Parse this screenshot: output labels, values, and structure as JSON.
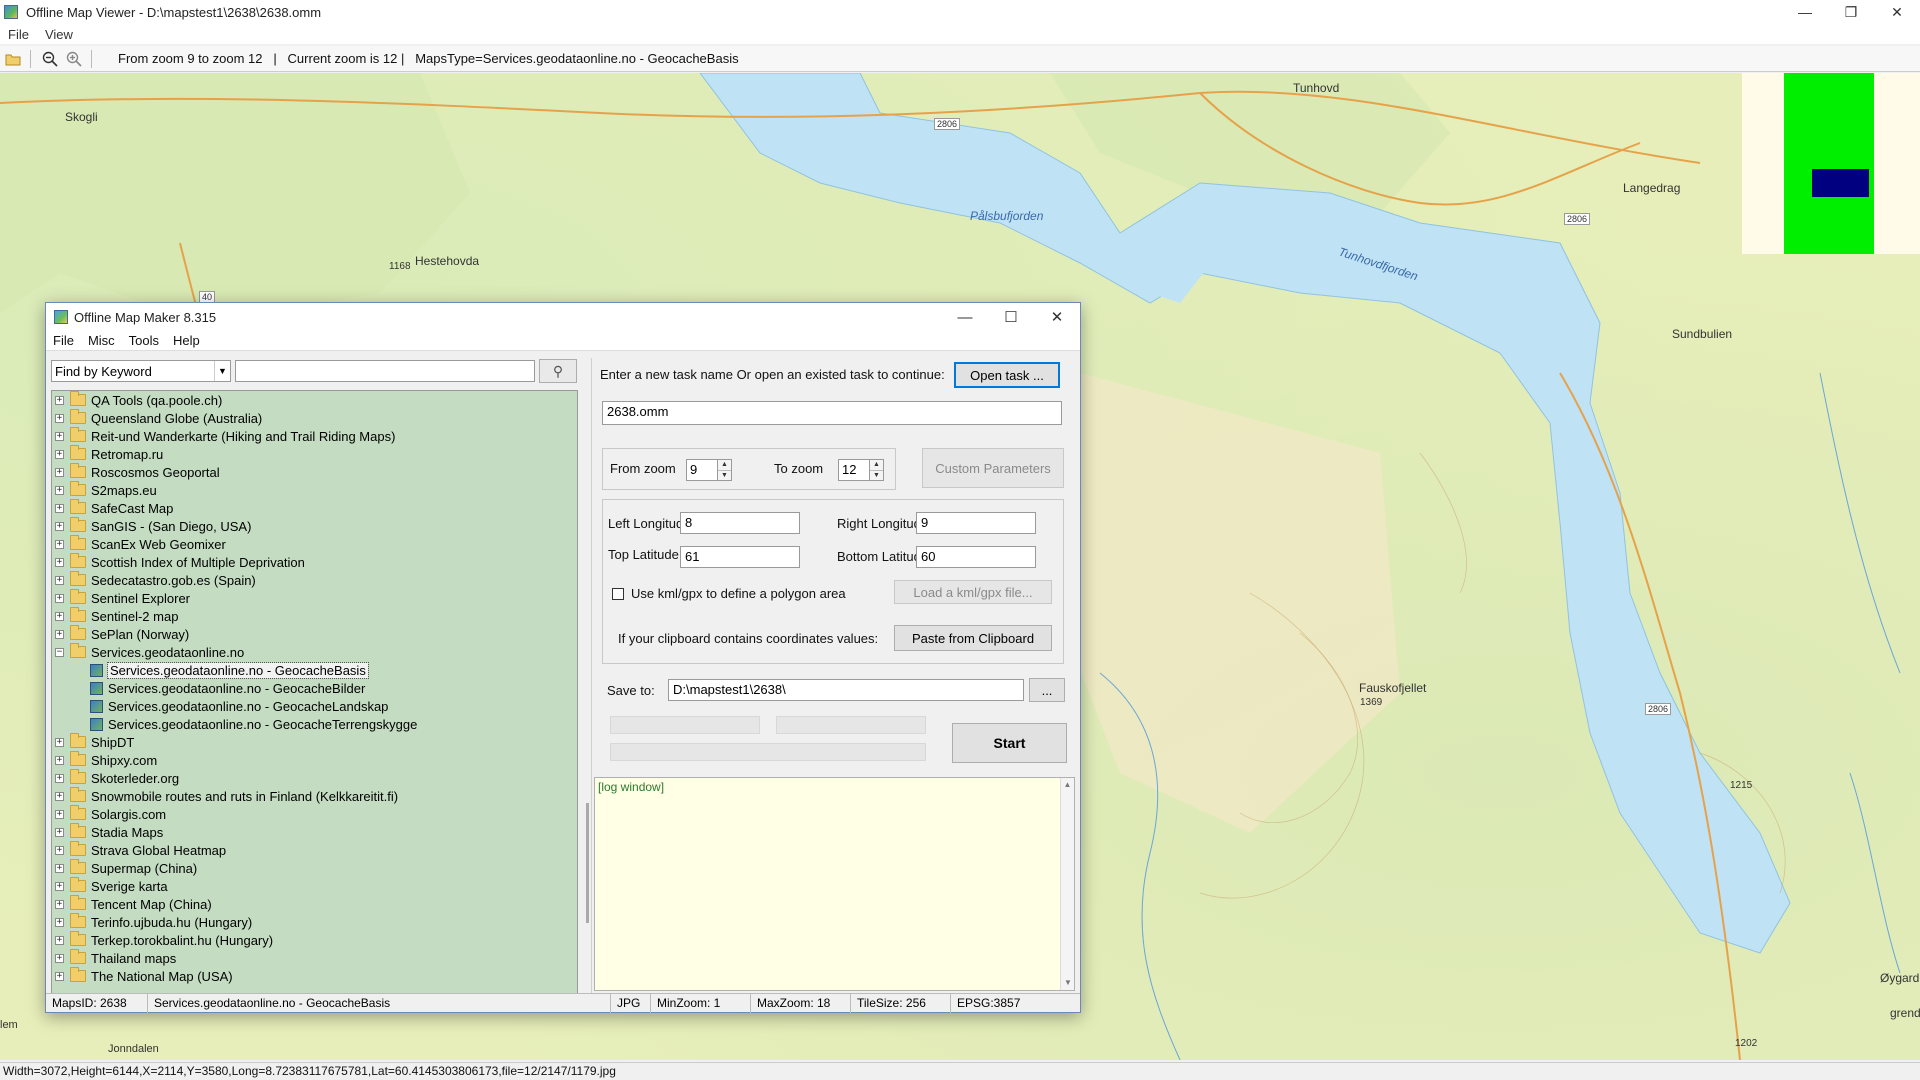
{
  "viewer": {
    "title": "Offline Map Viewer - D:\\mapstest1\\2638\\2638.omm",
    "menu": [
      "File",
      "View"
    ],
    "toolbar_info": "From zoom 9 to zoom 12   |   Current zoom is 12 |   MapsType=Services.geodataonline.no - GeocacheBasis",
    "status": "Width=3072,Height=6144,X=2114,Y=3580,Long=8.72383117675781,Lat=60.4145303806173,file=12/2147/1179.jpg",
    "window_controls": [
      "minimize-icon",
      "restore-icon",
      "close-icon"
    ]
  },
  "map": {
    "labels": {
      "skogli": "Skogli",
      "hestehovda": "Hestehovda",
      "hestehovda_elev": "1168",
      "tunhovd": "Tunhovd",
      "langedrag": "Langedrag",
      "sundbulien": "Sundbulien",
      "palsbufjorden": "Pålsbufjorden",
      "tunhovdfjorden": "Tunhovdfjorden",
      "fauskofjellet": "Fauskofjellet",
      "fauskofjellet_elev": "1369",
      "oygard": "Øygard",
      "grend": "grend",
      "jonndalen": "Jonndalen",
      "road_2806_a": "2806",
      "road_2806_b": "2806",
      "road_2806_c": "2806",
      "road_40": "40",
      "elev_1215": "1215",
      "elev_1202": "1202",
      "lenn": "lem"
    },
    "colors": {
      "land": "#e7eeb9",
      "water": "#bfe3f5",
      "road": "#e6a24a",
      "contour": "#c9a46b"
    }
  },
  "dialog": {
    "title": "Offline Map Maker 8.315",
    "menu": [
      "File",
      "Misc",
      "Tools",
      "Help"
    ],
    "search_mode": "Find by Keyword",
    "search_value": "",
    "tree": [
      {
        "label": "QA Tools (qa.poole.ch)",
        "type": "folder"
      },
      {
        "label": "Queensland Globe (Australia)",
        "type": "folder"
      },
      {
        "label": "Reit-und Wanderkarte (Hiking and Trail Riding Maps)",
        "type": "folder"
      },
      {
        "label": "Retromap.ru",
        "type": "folder"
      },
      {
        "label": "Roscosmos Geoportal",
        "type": "folder"
      },
      {
        "label": "S2maps.eu",
        "type": "folder"
      },
      {
        "label": "SafeCast Map",
        "type": "folder"
      },
      {
        "label": "SanGIS - (San Diego, USA)",
        "type": "folder"
      },
      {
        "label": "ScanEx Web Geomixer",
        "type": "folder"
      },
      {
        "label": "Scottish Index of Multiple Deprivation",
        "type": "folder"
      },
      {
        "label": "Sedecatastro.gob.es (Spain)",
        "type": "folder"
      },
      {
        "label": "Sentinel Explorer",
        "type": "folder"
      },
      {
        "label": "Sentinel-2 map",
        "type": "folder"
      },
      {
        "label": "SePlan (Norway)",
        "type": "folder"
      },
      {
        "label": "Services.geodataonline.no",
        "type": "folder-open"
      },
      {
        "label": "Services.geodataonline.no - GeocacheBasis",
        "type": "child",
        "selected": true
      },
      {
        "label": "Services.geodataonline.no - GeocacheBilder",
        "type": "child"
      },
      {
        "label": "Services.geodataonline.no - GeocacheLandskap",
        "type": "child"
      },
      {
        "label": "Services.geodataonline.no - GeocacheTerrengskygge",
        "type": "child"
      },
      {
        "label": "ShipDT",
        "type": "folder"
      },
      {
        "label": "Shipxy.com",
        "type": "folder"
      },
      {
        "label": "Skoterleder.org",
        "type": "folder"
      },
      {
        "label": "Snowmobile routes and ruts in Finland (Kelkkareitit.fi)",
        "type": "folder"
      },
      {
        "label": "Solargis.com",
        "type": "folder"
      },
      {
        "label": "Stadia Maps",
        "type": "folder"
      },
      {
        "label": "Strava Global Heatmap",
        "type": "folder"
      },
      {
        "label": "Supermap (China)",
        "type": "folder"
      },
      {
        "label": "Sverige karta",
        "type": "folder"
      },
      {
        "label": "Tencent Map (China)",
        "type": "folder"
      },
      {
        "label": "Terinfo.ujbuda.hu (Hungary)",
        "type": "folder"
      },
      {
        "label": "Terkep.torokbalint.hu (Hungary)",
        "type": "folder"
      },
      {
        "label": "Thailand maps",
        "type": "folder"
      },
      {
        "label": "The National Map (USA)",
        "type": "folder"
      }
    ],
    "form": {
      "prompt": "Enter a new task name Or open an existed task to continue:",
      "open_task": "Open task ...",
      "task_name": "2638.omm",
      "from_zoom_label": "From zoom",
      "from_zoom": "9",
      "to_zoom_label": "To zoom",
      "to_zoom": "12",
      "custom_params": "Custom Parameters",
      "left_lon_label": "Left Longitude",
      "left_lon": "8",
      "right_lon_label": "Right Longitude",
      "right_lon": "9",
      "top_lat_label": "Top Latitude",
      "top_lat": "61",
      "bottom_lat_label": "Bottom Latitude",
      "bottom_lat": "60",
      "kml_label": "Use kml/gpx to define a polygon area",
      "kml_checked": false,
      "load_kml": "Load a kml/gpx file...",
      "clipboard_label": "If your clipboard contains coordinates values:",
      "paste_btn": "Paste from Clipboard",
      "save_label": "Save to:",
      "save_path": "D:\\mapstest1\\2638\\",
      "browse_btn": "...",
      "start_btn": "Start",
      "log_text": "[log window]"
    },
    "status": {
      "maps_id": "MapsID: 2638",
      "maps_name": "Services.geodataonline.no - GeocacheBasis",
      "format": "JPG",
      "min_zoom": "MinZoom: 1",
      "max_zoom": "MaxZoom: 18",
      "tile_size": "TileSize: 256",
      "epsg": "EPSG:3857"
    },
    "window_controls": [
      "minimize-icon",
      "maximize-icon",
      "close-icon"
    ]
  }
}
